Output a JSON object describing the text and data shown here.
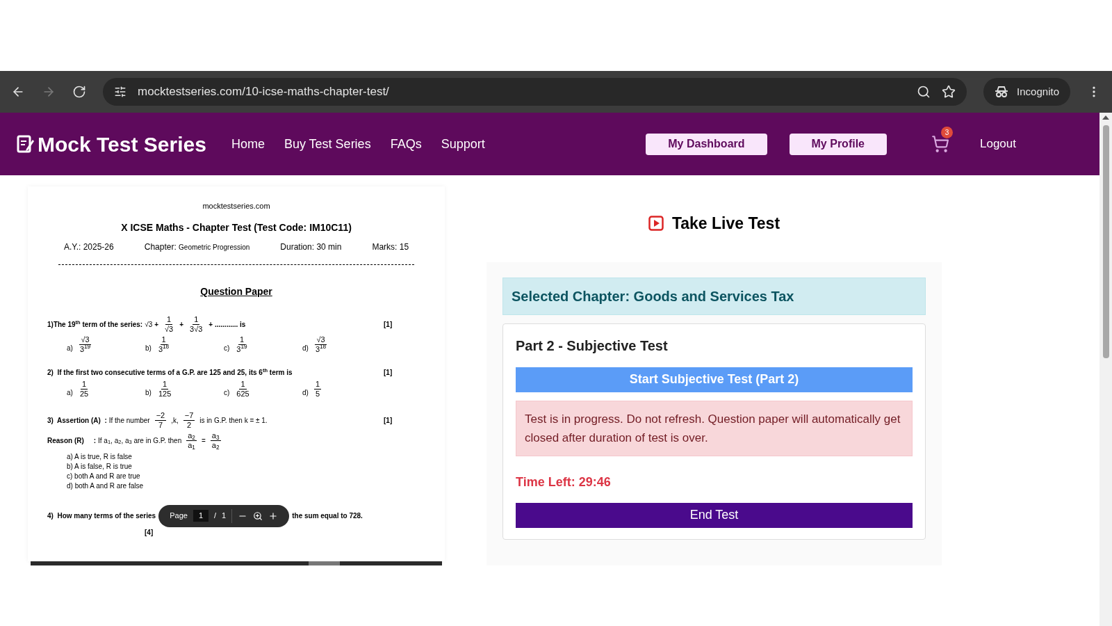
{
  "browser": {
    "nav": [
      {
        "kind": "back",
        "disabled": false
      },
      {
        "kind": "forward",
        "disabled": true
      },
      {
        "kind": "reload",
        "disabled": false
      }
    ],
    "url": "mocktestseries.com/10-icse-maths-chapter-test/",
    "profile": "Incognito"
  },
  "header": {
    "logo": "Mock Test Series",
    "nav": [
      "Home",
      "Buy Test Series",
      "FAQs",
      "Support"
    ],
    "buttons": [
      "My Dashboard",
      "My Profile"
    ],
    "cart_count": "3",
    "logout": "Logout"
  },
  "paper": {
    "site": "mocktestseries.com",
    "title": "X ICSE Maths - Chapter Test (Test Code: IM10C11)",
    "meta": [
      {
        "label": "A.Y.:",
        "value": "2025-26",
        "small": false
      },
      {
        "label": "Chapter:",
        "value": "Geometric Progression",
        "small": true
      },
      {
        "label": "Duration:",
        "value": "30 min",
        "small": false
      },
      {
        "label": "Marks:",
        "value": "15",
        "small": false
      }
    ],
    "heading": "Question Paper",
    "questions": [
      {
        "lines": [
          {
            "segments": [
              {
                "kind": "bold",
                "text": "1)The 19$^{th}$ term of the series:"
              },
              {
                "kind": "text",
                "text": "√3"
              },
              {
                "kind": "bold",
                "text": "+"
              },
              {
                "kind": "frac",
                "num": "1",
                "den": "√3"
              },
              {
                "kind": "bold",
                "text": "+"
              },
              {
                "kind": "frac",
                "num": "1",
                "den": "3√3"
              },
              {
                "kind": "bold",
                "text": "+ ............ is"
              }
            ],
            "marks": "[1]"
          }
        ],
        "options": [
          {
            "kind": "frac",
            "label": "a)",
            "num": "√3",
            "den": "3$^{19}$"
          },
          {
            "kind": "frac",
            "label": "b)",
            "num": "1",
            "den": "3$^{18}$"
          },
          {
            "kind": "frac",
            "label": "c)",
            "num": "1",
            "den": "3$^{19}$"
          },
          {
            "kind": "frac",
            "label": "d)",
            "num": "√3",
            "den": "3$^{18}$"
          }
        ]
      },
      {
        "lines": [
          {
            "segments": [
              {
                "kind": "bold",
                "text": "2)  If the first two consecutive terms of a G.P. are 125 and 25, its 6$^{th}$ term is"
              }
            ],
            "marks": "[1]"
          }
        ],
        "options": [
          {
            "kind": "frac",
            "label": "a)",
            "num": "1",
            "den": "25"
          },
          {
            "kind": "frac",
            "label": "b)",
            "num": "1",
            "den": "125"
          },
          {
            "kind": "frac",
            "label": "c)",
            "num": "1",
            "den": "625"
          },
          {
            "kind": "frac",
            "label": "d)",
            "num": "1",
            "den": "5"
          }
        ]
      },
      {
        "lines": [
          {
            "segments": [
              {
                "kind": "bold",
                "text": "3)  Assertion (A)  :"
              },
              {
                "kind": "text",
                "text": "If the number"
              },
              {
                "kind": "frac",
                "num": "−2",
                "den": "7"
              },
              {
                "kind": "text",
                "text": ",k,"
              },
              {
                "kind": "frac",
                "num": "−7",
                "den": "2"
              },
              {
                "kind": "text",
                "text": "is in G.P. then k = ± 1."
              }
            ],
            "marks": "[1]"
          },
          {
            "segments": [
              {
                "kind": "bold",
                "text": "Reason (R)     :"
              },
              {
                "kind": "text",
                "text": "If a$_{1}$, a$_{2}$, a$_{3}$ are in G.P. then"
              },
              {
                "kind": "frac",
                "num": "a$_{2}$",
                "den": "a$_{1}$"
              },
              {
                "kind": "text",
                "text": "="
              },
              {
                "kind": "frac",
                "num": "a$_{3}$",
                "den": "a$_{2}$"
              }
            ]
          }
        ],
        "options": [
          {
            "kind": "text",
            "label": "a)",
            "text": "A is true, R is false"
          },
          {
            "kind": "text",
            "label": "b)",
            "text": "A is false, R is true"
          },
          {
            "kind": "text",
            "label": "c)",
            "text": "both A and R are true"
          },
          {
            "kind": "text",
            "label": "d)",
            "text": "both A and R are false"
          }
        ]
      }
    ],
    "last_question": {
      "before": "4)  How many terms of the series",
      "after": "the sum equal to 728.",
      "marks": "[4]"
    },
    "toolbar": {
      "label": "Page",
      "page": "1",
      "separator": "/",
      "total": "1"
    }
  },
  "test": {
    "title": "Take Live Test",
    "chapter": "Selected Chapter: Goods and Services Tax",
    "part": "Part 2 - Subjective Test",
    "start": "Start Subjective Test (Part 2)",
    "alert": "Test is in progress. Do not refresh. Question paper will automatically get closed after duration of test is over.",
    "time_left": "Time Left: 29:46",
    "end": "End Test"
  }
}
